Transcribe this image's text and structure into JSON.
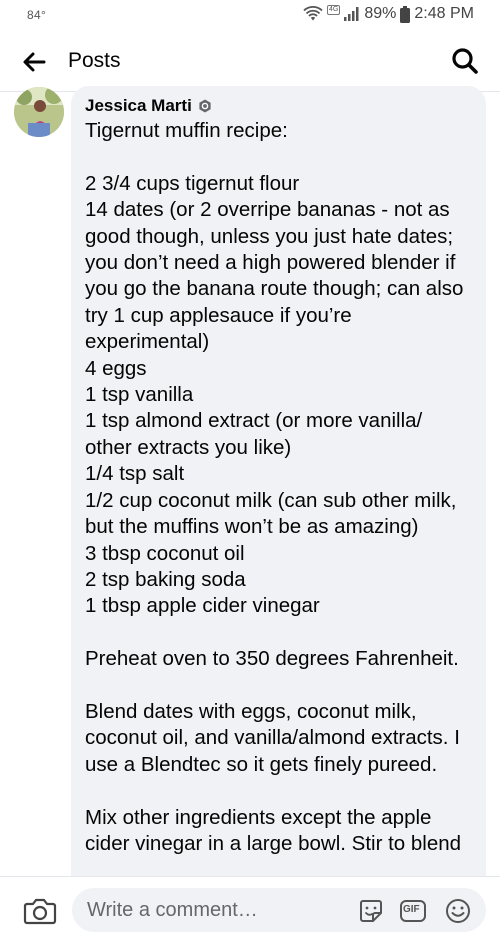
{
  "status_bar": {
    "temperature": "84°",
    "network_badge": "4G",
    "battery": "89%",
    "time": "2:48 PM"
  },
  "header": {
    "title": "Posts",
    "back_icon": "arrow-left-icon",
    "search_icon": "search-icon"
  },
  "comment": {
    "author": "Jessica Marti",
    "badge_icon": "top-fan-badge-icon",
    "text": "Tigernut muffin recipe:\n\n2 3/4 cups tigernut flour\n14 dates (or 2 overripe bananas - not as good though, unless you just hate dates; you don’t need a high powered blender if you go the banana route though; can also try 1 cup applesauce if you’re experimental)\n4 eggs\n1 tsp vanilla\n1 tsp almond extract (or more vanilla/ other extracts you like)\n1/4 tsp salt\n1/2 cup coconut milk (can sub other milk, but the muffins won’t be as amazing)\n3 tbsp coconut oil\n2 tsp baking soda\n1 tbsp apple cider vinegar\n\nPreheat oven to 350 degrees Fahrenheit.\n\nBlend dates with eggs, coconut milk, coconut oil, and vanilla/almond extracts. I use a Blendtec so it gets finely pureed.\n\nMix other ingredients except the apple cider vinegar in a large bowl. Stir to blend"
  },
  "composer": {
    "placeholder": "Write a comment…",
    "camera_icon": "camera-icon",
    "sticker_icon": "sticker-icon",
    "gif_label": "GIF",
    "emoji_icon": "emoji-icon"
  }
}
